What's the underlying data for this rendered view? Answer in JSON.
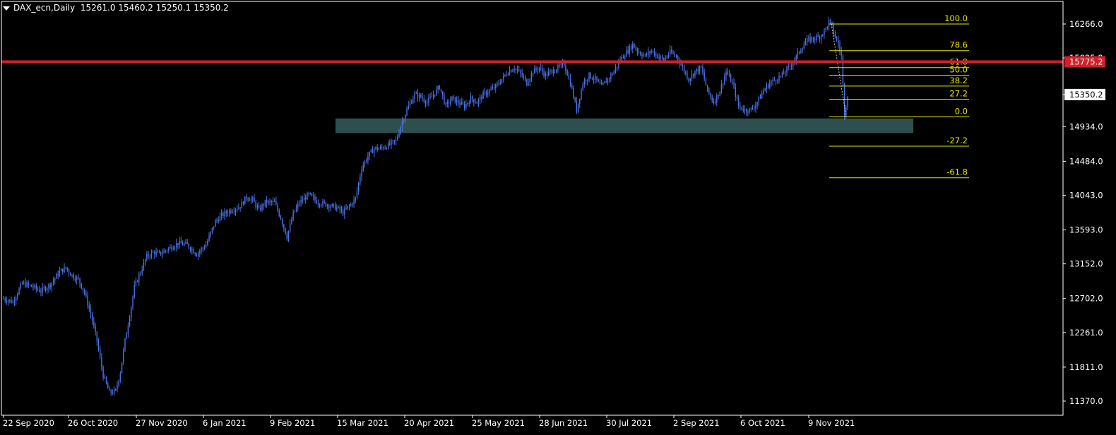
{
  "header": {
    "symbol": "DAX_ecn,Daily",
    "ohlc": "15261.0 15460.2 15250.1 15350.2"
  },
  "colors": {
    "background": "#000000",
    "candle": "#4a73e8",
    "axis": "#ffffff",
    "fib": "#e6e600",
    "resistance": "#d0202a",
    "support_zone": "#2f4f4f",
    "price_tag_bg": "#ffffff",
    "price_tag_fg": "#000000"
  },
  "chart_data": {
    "type": "candlestick",
    "x_tick_labels": [
      "22 Sep 2020",
      "26 Oct 2020",
      "27 Nov 2020",
      "6 Jan 2021",
      "9 Feb 2021",
      "15 Mar 2021",
      "20 Apr 2021",
      "25 May 2021",
      "28 Jun 2021",
      "30 Jul 2021",
      "2 Sep 2021",
      "6 Oct 2021",
      "9 Nov 2021"
    ],
    "y_tick_labels": [
      "16266.0",
      "15825.8",
      "15350.2",
      "14934.0",
      "14484.0",
      "14043.0",
      "13593.0",
      "13152.0",
      "12702.0",
      "12261.0",
      "11811.0",
      "11370.0"
    ],
    "y_ticks": [
      16266.0,
      15825.8,
      15350.2,
      14934.0,
      14484.0,
      14043.0,
      13593.0,
      13152.0,
      12702.0,
      12261.0,
      11811.0,
      11370.0
    ],
    "ylim": [
      11370.0,
      16266.0
    ],
    "close_path": [
      [
        0,
        12700
      ],
      [
        6,
        12660
      ],
      [
        12,
        12900
      ],
      [
        18,
        12860
      ],
      [
        24,
        12800
      ],
      [
        30,
        12880
      ],
      [
        36,
        13050
      ],
      [
        40,
        13100
      ],
      [
        44,
        13000
      ],
      [
        48,
        12950
      ],
      [
        52,
        12780
      ],
      [
        56,
        12500
      ],
      [
        60,
        12150
      ],
      [
        64,
        11700
      ],
      [
        68,
        11480
      ],
      [
        72,
        11500
      ],
      [
        75,
        11750
      ],
      [
        78,
        12150
      ],
      [
        82,
        12600
      ],
      [
        84,
        12850
      ],
      [
        88,
        13050
      ],
      [
        92,
        13250
      ],
      [
        96,
        13300
      ],
      [
        100,
        13280
      ],
      [
        106,
        13350
      ],
      [
        112,
        13420
      ],
      [
        118,
        13400
      ],
      [
        124,
        13280
      ],
      [
        130,
        13400
      ],
      [
        136,
        13700
      ],
      [
        140,
        13780
      ],
      [
        146,
        13850
      ],
      [
        152,
        13900
      ],
      [
        156,
        14020
      ],
      [
        160,
        13980
      ],
      [
        164,
        13850
      ],
      [
        168,
        13950
      ],
      [
        174,
        13950
      ],
      [
        178,
        13750
      ],
      [
        182,
        13500
      ],
      [
        186,
        13800
      ],
      [
        190,
        13950
      ],
      [
        196,
        14050
      ],
      [
        202,
        13950
      ],
      [
        208,
        13920
      ],
      [
        214,
        13880
      ],
      [
        218,
        13820
      ],
      [
        222,
        13900
      ],
      [
        226,
        14000
      ],
      [
        230,
        14400
      ],
      [
        234,
        14550
      ],
      [
        238,
        14650
      ],
      [
        242,
        14650
      ],
      [
        248,
        14700
      ],
      [
        252,
        14750
      ],
      [
        256,
        15000
      ],
      [
        260,
        15200
      ],
      [
        264,
        15350
      ],
      [
        268,
        15320
      ],
      [
        272,
        15250
      ],
      [
        276,
        15350
      ],
      [
        280,
        15450
      ],
      [
        284,
        15200
      ],
      [
        288,
        15300
      ],
      [
        292,
        15250
      ],
      [
        296,
        15200
      ],
      [
        300,
        15300
      ],
      [
        304,
        15250
      ],
      [
        308,
        15350
      ],
      [
        312,
        15400
      ],
      [
        316,
        15450
      ],
      [
        320,
        15550
      ],
      [
        324,
        15650
      ],
      [
        328,
        15700
      ],
      [
        332,
        15620
      ],
      [
        336,
        15500
      ],
      [
        340,
        15650
      ],
      [
        344,
        15700
      ],
      [
        348,
        15600
      ],
      [
        352,
        15650
      ],
      [
        356,
        15700
      ],
      [
        360,
        15750
      ],
      [
        364,
        15500
      ],
      [
        368,
        15150
      ],
      [
        372,
        15500
      ],
      [
        376,
        15600
      ],
      [
        380,
        15550
      ],
      [
        384,
        15450
      ],
      [
        388,
        15550
      ],
      [
        392,
        15650
      ],
      [
        396,
        15800
      ],
      [
        400,
        15900
      ],
      [
        404,
        16000
      ],
      [
        408,
        15900
      ],
      [
        412,
        15850
      ],
      [
        416,
        15920
      ],
      [
        420,
        15850
      ],
      [
        424,
        15800
      ],
      [
        428,
        15900
      ],
      [
        432,
        15850
      ],
      [
        436,
        15700
      ],
      [
        440,
        15550
      ],
      [
        444,
        15650
      ],
      [
        448,
        15700
      ],
      [
        452,
        15400
      ],
      [
        456,
        15250
      ],
      [
        460,
        15400
      ],
      [
        464,
        15650
      ],
      [
        468,
        15500
      ],
      [
        472,
        15200
      ],
      [
        476,
        15150
      ],
      [
        480,
        15150
      ],
      [
        484,
        15250
      ],
      [
        488,
        15400
      ],
      [
        492,
        15500
      ],
      [
        496,
        15550
      ],
      [
        500,
        15600
      ],
      [
        504,
        15700
      ],
      [
        508,
        15800
      ],
      [
        512,
        15950
      ],
      [
        516,
        16050
      ],
      [
        520,
        16080
      ],
      [
        524,
        16100
      ],
      [
        528,
        16200
      ],
      [
        530,
        16300
      ],
      [
        532,
        16220
      ],
      [
        534,
        16100
      ],
      [
        536,
        16000
      ],
      [
        538,
        15850
      ],
      [
        540,
        15100
      ],
      [
        542,
        15350
      ]
    ],
    "levels": {
      "resistance": 15775.2,
      "support_zone": [
        14850,
        15040
      ]
    },
    "fibonacci": [
      {
        "label": "100.0",
        "price": 16266.0
      },
      {
        "label": "78.6",
        "price": 15920.0
      },
      {
        "label": "61.8",
        "price": 15700.0
      },
      {
        "label": "50.0",
        "price": 15600.0
      },
      {
        "label": "38.2",
        "price": 15460.0
      },
      {
        "label": "27.2",
        "price": 15290.0
      },
      {
        "label": "0.0",
        "price": 15060.0
      },
      {
        "label": "-27.2",
        "price": 14680.0
      },
      {
        "label": "-61.8",
        "price": 14270.0
      }
    ],
    "current_price_label": "15350.2",
    "resistance_label": "15775.2"
  }
}
